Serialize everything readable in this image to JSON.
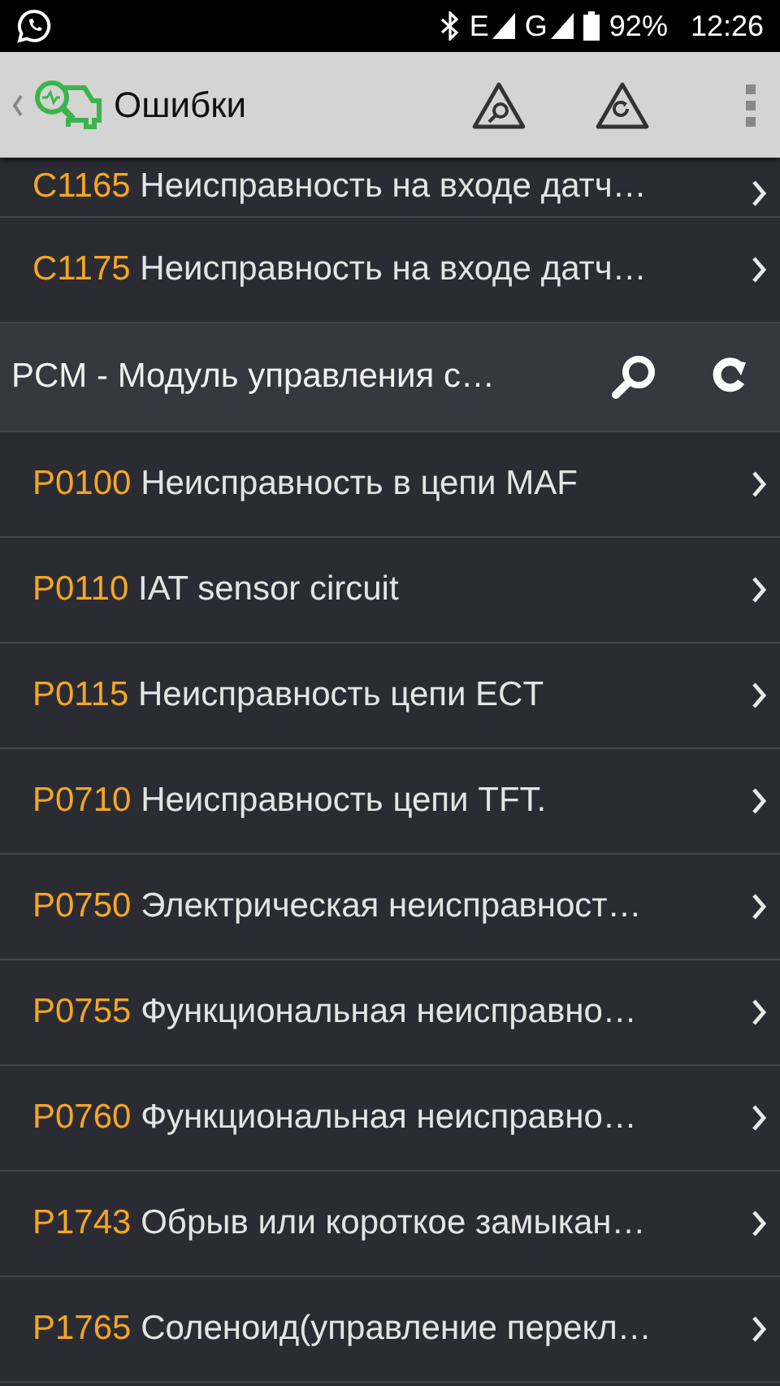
{
  "status_bar": {
    "network_1": "E",
    "network_2": "G",
    "battery": "92%",
    "time": "12:26"
  },
  "app_bar": {
    "title": "Ошибки"
  },
  "groups": [
    {
      "rows": [
        {
          "code": "C1165",
          "text": "Неисправность на входе датч…"
        },
        {
          "code": "C1175",
          "text": "Неисправность на входе датч…"
        }
      ]
    },
    {
      "header": "PCM - Модуль управления с…",
      "rows": [
        {
          "code": "P0100",
          "text": "Неисправность в цепи MAF"
        },
        {
          "code": "P0110",
          "text": "IAT sensor circuit"
        },
        {
          "code": "P0115",
          "text": "Неисправность цепи ECT"
        },
        {
          "code": "P0710",
          "text": "Неисправность цепи TFT."
        },
        {
          "code": "P0750",
          "text": "Электрическая неисправност…"
        },
        {
          "code": "P0755",
          "text": "Функциональная неисправно…"
        },
        {
          "code": "P0760",
          "text": "Функциональная неисправно…"
        },
        {
          "code": "P1743",
          "text": "Обрыв или короткое замыкан…"
        },
        {
          "code": "P1765",
          "text": "Соленоид(управление перекл…"
        }
      ]
    }
  ]
}
